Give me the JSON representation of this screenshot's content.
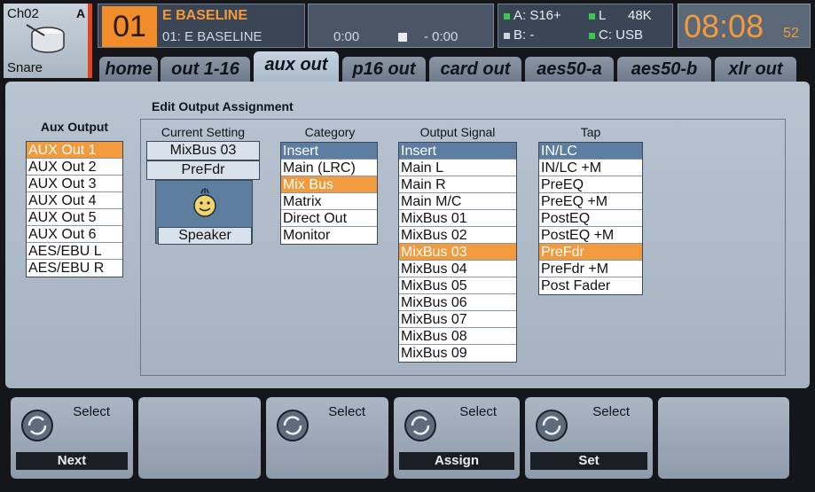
{
  "channel": {
    "id": "Ch02",
    "flag": "A",
    "name": "Snare"
  },
  "scene": {
    "number": "01",
    "title": "E BASELINE",
    "subtitle": "01: E BASELINE"
  },
  "transport": {
    "time_elapsed": "0:00",
    "time_remaining": "- 0:00"
  },
  "io": {
    "a": "A: S16+",
    "b": "B:  -",
    "l": "L",
    "rate": "48K",
    "c": "C: USB"
  },
  "clock": {
    "time": "08:08",
    "seconds": "52"
  },
  "tabs": [
    "home",
    "out 1-16",
    "aux out",
    "p16 out",
    "card out",
    "aes50-a",
    "aes50-b",
    "xlr out"
  ],
  "active_tab": "aux out",
  "aux_output": {
    "header": "Aux Output",
    "items": [
      "AUX Out 1",
      "AUX Out 2",
      "AUX Out 3",
      "AUX Out 4",
      "AUX Out 5",
      "AUX Out 6",
      "AES/EBU L",
      "AES/EBU R"
    ],
    "selected": "AUX Out 1"
  },
  "edit_title": "Edit Output Assignment",
  "current_setting": {
    "header": "Current Setting",
    "bus": "MixBus 03",
    "tap": "PreFdr",
    "icon_label": "Speaker"
  },
  "category": {
    "header": "Category",
    "items": [
      "Insert",
      "Main (LRC)",
      "Mix Bus",
      "Matrix",
      "Direct Out",
      "Monitor"
    ],
    "highlight": "Insert",
    "selected": "Mix Bus"
  },
  "output_signal": {
    "header": "Output Signal",
    "items": [
      "Insert",
      "Main L",
      "Main R",
      "Main M/C",
      "MixBus 01",
      "MixBus 02",
      "MixBus 03",
      "MixBus 04",
      "MixBus 05",
      "MixBus 06",
      "MixBus 07",
      "MixBus 08",
      "MixBus 09"
    ],
    "highlight": "Insert",
    "selected": "MixBus 03"
  },
  "tap": {
    "header": "Tap",
    "items": [
      "IN/LC",
      "IN/LC +M",
      "PreEQ",
      "PreEQ +M",
      "PostEQ",
      "PostEQ +M",
      "PreFdr",
      "PreFdr +M",
      "Post Fader"
    ],
    "highlight": "IN/LC",
    "selected": "PreFdr"
  },
  "softkeys": [
    {
      "label": "Select",
      "action": "Next"
    },
    {
      "label": "",
      "action": ""
    },
    {
      "label": "Select",
      "action": ""
    },
    {
      "label": "Select",
      "action": "Assign"
    },
    {
      "label": "Select",
      "action": "Set"
    },
    {
      "label": "",
      "action": ""
    }
  ],
  "colors": {
    "accent": "#f29a3e",
    "header_row": "#5d7ea0",
    "channel_flag": "#e2451e",
    "io_green": "#37c74a"
  }
}
